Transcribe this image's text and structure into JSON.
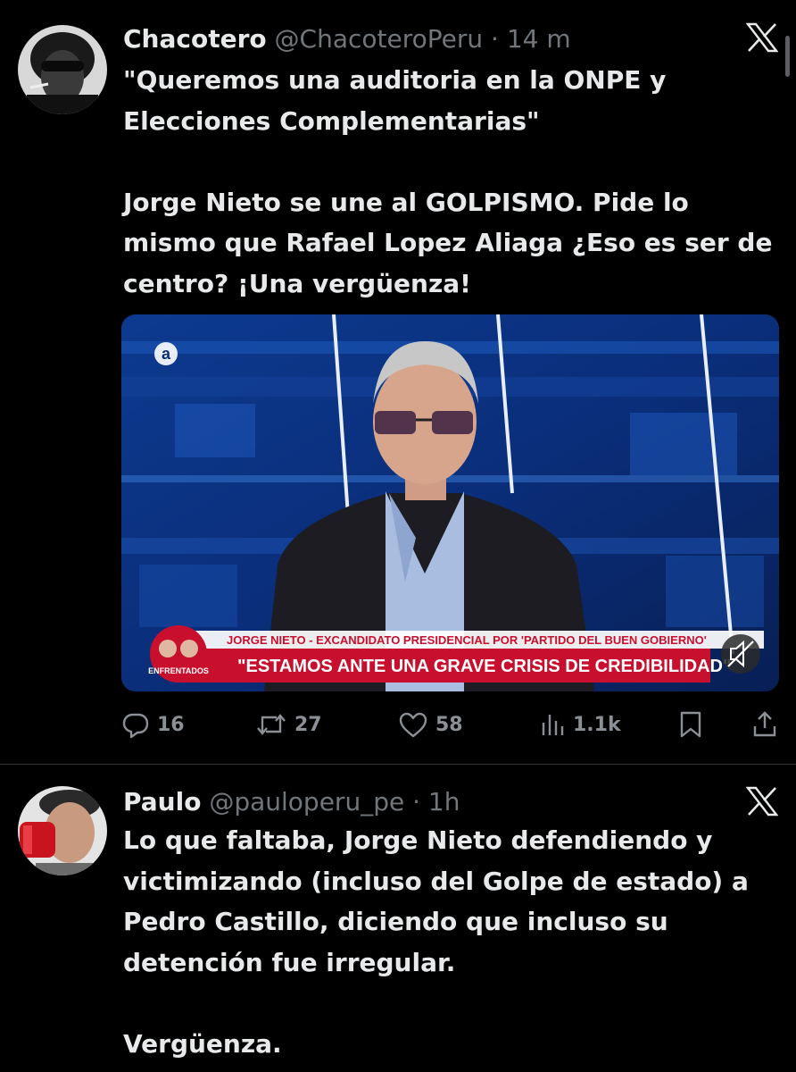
{
  "tweets": [
    {
      "display_name": "Chacotero",
      "handle": "@ChacoteroPeru",
      "separator": "·",
      "time": "14 m",
      "text": "\"Queremos una auditoria en la ONPE y Elecciones Complementarias\"\n\nJorge Nieto se une al GOLPISMO. Pide lo mismo que Rafael Lopez Aliaga ¿Eso es ser de centro? ¡Una vergüenza!",
      "media": {
        "channel_logo": "a",
        "lower_third_label": "ENFRENTADOS",
        "headline": "JORGE NIETO - EXCANDIDATO PRESIDENCIAL POR 'PARTIDO DEL BUEN GOBIERNO'",
        "quote": "\"ESTAMOS ANTE UNA GRAVE CRISIS DE CREDIBILIDAD\"",
        "mute_icon": "speaker-muted-icon"
      },
      "actions": {
        "replies": "16",
        "reposts": "27",
        "likes": "58",
        "views": "1.1k"
      }
    },
    {
      "display_name": "Paulo",
      "handle": "@pauloperu_pe",
      "separator": "·",
      "time": "1h",
      "text": "Lo que faltaba, Jorge Nieto defendiendo y victimizando (incluso del Golpe de estado) a Pedro Castillo, diciendo que incluso su detención fue irregular.\n\nVergüenza."
    }
  ],
  "colors": {
    "background": "#000000",
    "text": "#e7e9ea",
    "secondary": "#71767b",
    "divider": "#2f3336",
    "lower_third_red": "#c8102e"
  },
  "icons": [
    "reply-icon",
    "repost-icon",
    "like-icon",
    "views-icon",
    "bookmark-icon",
    "share-icon",
    "x-logo-icon"
  ]
}
